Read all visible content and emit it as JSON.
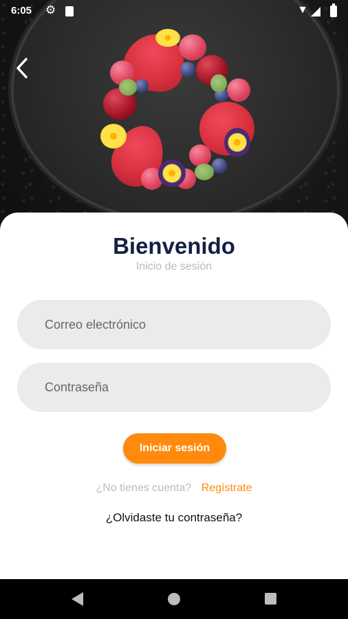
{
  "status_bar": {
    "time": "6:05",
    "icons": [
      "gear-icon",
      "sd-card-icon",
      "wifi-icon",
      "signal-icon",
      "battery-icon"
    ]
  },
  "hero": {
    "image_description": "red raspberry mousse dessert on dark plate",
    "back_icon": "chevron-left-icon"
  },
  "login": {
    "title": "Bienvenido",
    "subtitle": "Inicio de sesión",
    "email_placeholder": "Correo electrónico",
    "password_placeholder": "Contraseña",
    "login_button": "Iniciar sesión",
    "no_account_text": "¿No tienes cuenta?",
    "register_link": "Regístrate",
    "forgot_password": "¿Olvidaste tu contraseña?"
  },
  "colors": {
    "accent": "#ff8a0d",
    "title": "#142042",
    "muted": "#b8b8c4",
    "field_bg": "#ebebeb"
  },
  "nav_bar": {
    "icons": [
      "nav-back-icon",
      "nav-home-icon",
      "nav-recents-icon"
    ]
  }
}
